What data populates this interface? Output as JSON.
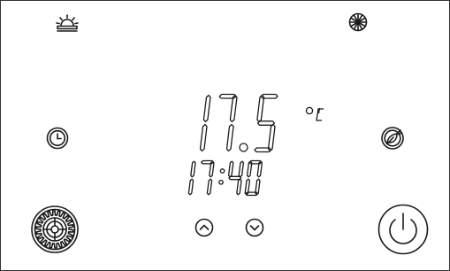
{
  "display": {
    "temperature": "17.5",
    "temperature_unit": "°C",
    "time": "17:40"
  },
  "status": {
    "heat_mode_icon": "sun-heat-icon",
    "cool_mode_icon": "snowflake-icon"
  },
  "controls": {
    "left_top": "clock-schedule-icon",
    "left_bottom": "settings-gear-icon",
    "right_top": "eco-leaf-icon",
    "right_bottom": "power-icon",
    "up": "chevron-up-icon",
    "down": "chevron-down-icon"
  },
  "colors": {
    "ink": "#1a1a1a",
    "background": "#ffffff",
    "frame": "#333333"
  }
}
